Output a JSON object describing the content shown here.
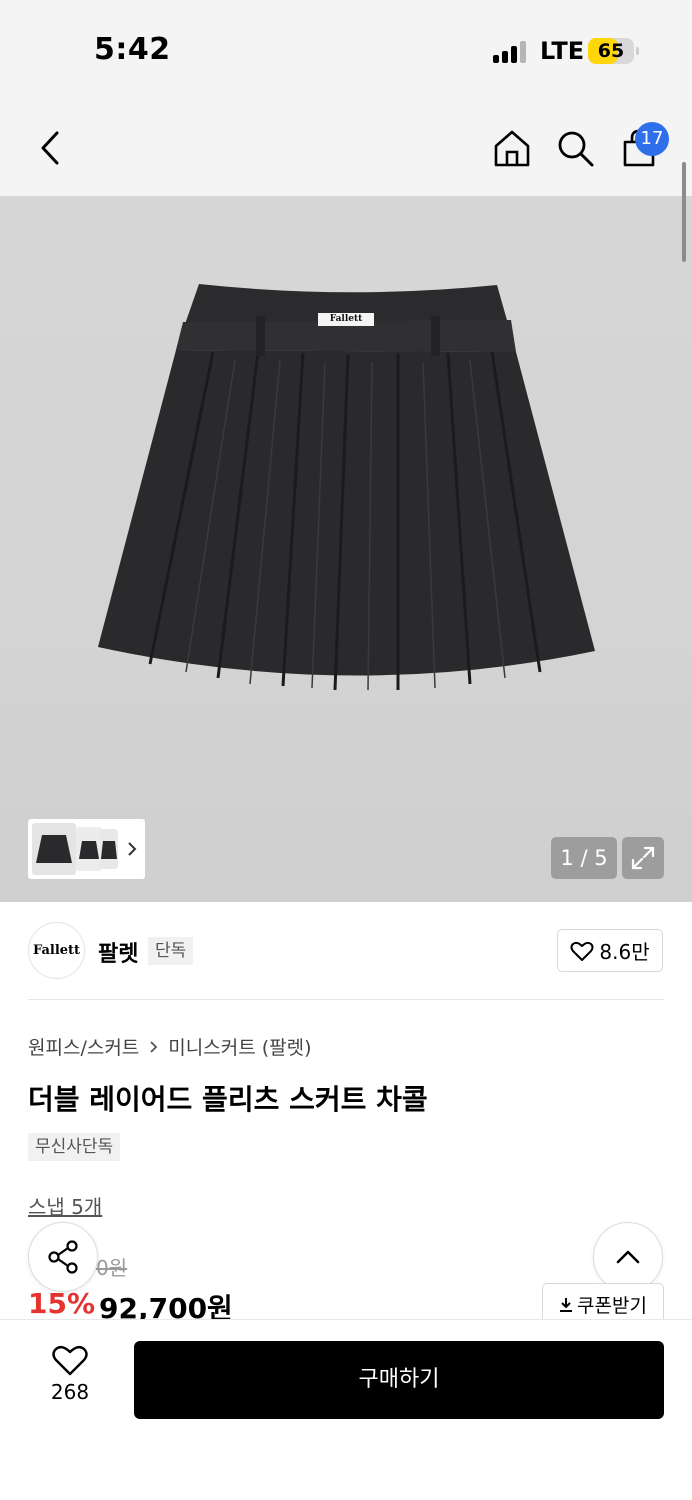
{
  "status_bar": {
    "time": "5:42",
    "network": "LTE",
    "battery": "65",
    "battery_level": 0.65
  },
  "nav": {
    "back_icon": "chevron-left-icon",
    "home_icon": "home-icon",
    "search_icon": "search-icon",
    "cart_icon": "shopping-bag-icon",
    "cart_count": "17"
  },
  "gallery": {
    "counter": "1 / 5",
    "thumbs_next_icon": "chevron-right-icon",
    "expand_icon": "expand-icon",
    "product_logo": "Fallett"
  },
  "brand": {
    "logo_text": "Fallett",
    "name": "팔렛",
    "tag": "단독",
    "likes": "8.6만",
    "like_icon": "heart-outline-icon"
  },
  "product": {
    "breadcrumb": [
      "원피스/스커트",
      "미니스커트 (팔렛)"
    ],
    "title": "더블 레이어드 플리츠 스커트 차콜",
    "exclusive_badge": "무신사단독",
    "snap": "스냅 5개",
    "original_price": "0원",
    "discount": "15%",
    "price": "92,700원"
  },
  "floating": {
    "share_icon": "share-icon",
    "top_icon": "chevron-up-icon",
    "coupon_label": "쿠폰받기",
    "coupon_icon": "download-icon"
  },
  "bottom_bar": {
    "wish_count": "268",
    "wish_icon": "heart-outline-icon",
    "buy_label": "구매하기"
  },
  "colors": {
    "accent_blue": "#2f6fea",
    "discount_red": "#e3342f",
    "battery_yellow": "#ffd60a"
  }
}
